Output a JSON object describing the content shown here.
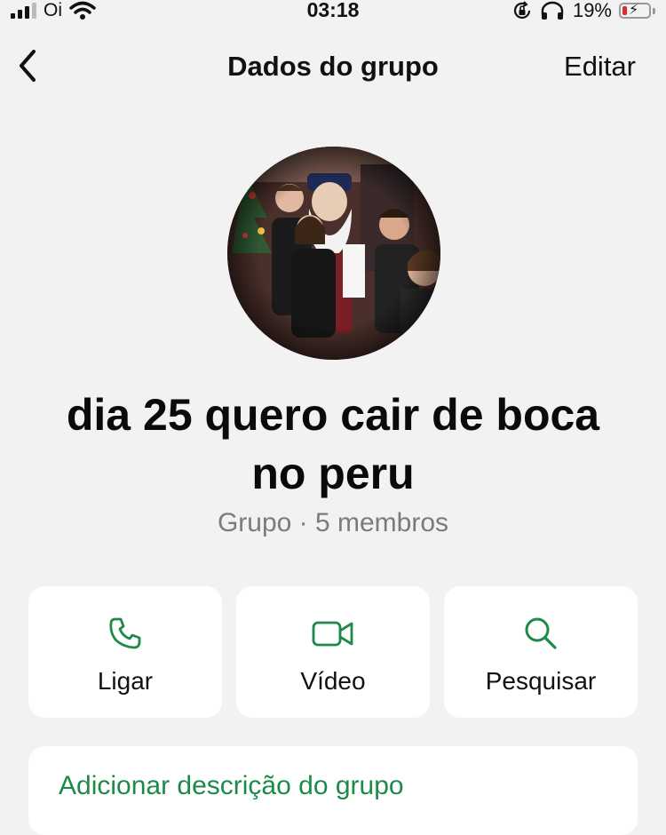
{
  "status_bar": {
    "carrier": "Oi",
    "time": "03:18",
    "battery_percent": "19%",
    "battery_level": 0.19,
    "icons": [
      "signal-icon",
      "wifi-icon",
      "rotation-lock-icon",
      "headphones-icon",
      "battery-charging-icon"
    ]
  },
  "nav": {
    "title": "Dados do grupo",
    "edit_label": "Editar",
    "back_icon": "chevron-left-icon"
  },
  "group": {
    "name": "dia 25 quero cair de boca no peru",
    "meta": "Grupo · 5 membros",
    "avatar": "group-photo"
  },
  "actions": [
    {
      "label": "Ligar",
      "icon": "phone-icon"
    },
    {
      "label": "Vídeo",
      "icon": "video-camera-icon"
    },
    {
      "label": "Pesquisar",
      "icon": "search-icon"
    }
  ],
  "description": {
    "add_label": "Adicionar descrição do grupo"
  },
  "colors": {
    "accent": "#1d8b47",
    "background": "#f2f2f2",
    "card": "#ffffff",
    "battery_low": "#e0292c"
  }
}
